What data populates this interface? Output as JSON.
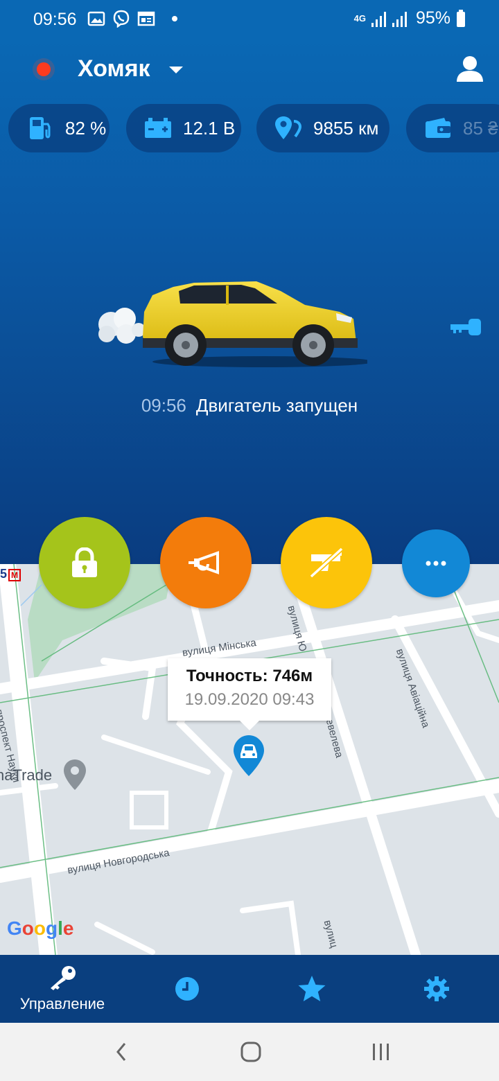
{
  "status_bar": {
    "time": "09:56",
    "network": "4G",
    "battery": "95%"
  },
  "header": {
    "car_name": "Хомяк",
    "connection_color": "#ff3b1f"
  },
  "chips": {
    "fuel": "82 %",
    "battery_voltage": "12.1 В",
    "mileage": "9855 км",
    "balance": "85 ₴"
  },
  "engine": {
    "time": "09:56",
    "status": "Двигатель запущен"
  },
  "map": {
    "metro_line": "5",
    "metro_icon": "M",
    "streets": {
      "prospect": "проспект Науки",
      "minska": "вулиця Мінська",
      "yu": "вулиця Ю",
      "yu_tail": "шевелева",
      "aviatsiyna": "вулиця Авіаційна",
      "novgorodska": "вулиця Новгородська",
      "bottom": "вулиц"
    },
    "poi": "naTrade",
    "google": [
      "G",
      "o",
      "o",
      "g",
      "l",
      "e"
    ],
    "tooltip": {
      "accuracy": "Точность: 746м",
      "datetime": "19.09.2020 09:43"
    }
  },
  "actions": {
    "colors": {
      "lock": "#a5c41b",
      "horn": "#f37c0b",
      "alarm": "#fcc40a",
      "more": "#1288d6"
    }
  },
  "bottom_nav": {
    "control_label": "Управление"
  },
  "colors": {
    "accent": "#2fb2ff",
    "nav_bg": "#0a3f7f"
  }
}
